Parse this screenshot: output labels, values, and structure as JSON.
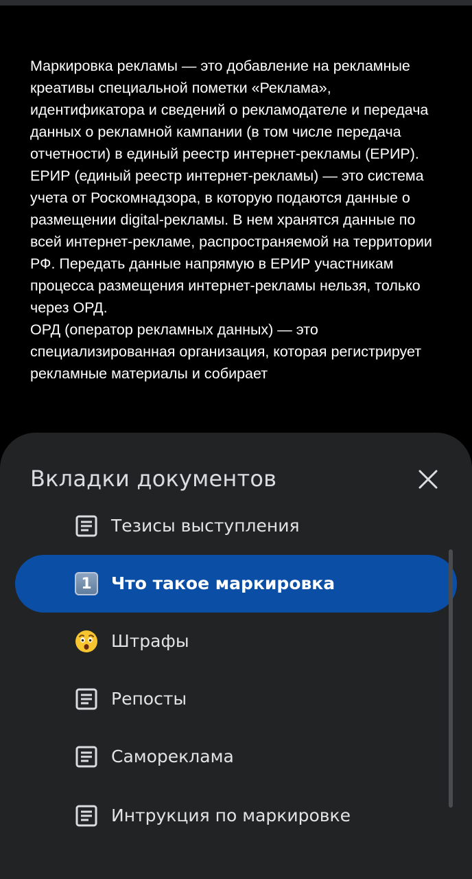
{
  "document": {
    "paragraphs": [
      "Маркировка рекламы — это добавление на рекламные креативы специальной пометки «Реклама», идентификатора и сведений о рекламодателе и передача данных о рекламной кампании (в том числе передача отчетности) в единый реестр интернет-рекламы (ЕРИР).",
      "ЕРИР (единый реестр интернет-рекламы) — это система учета от Роскомнадзора, в которую подаются данные о размещении digital-рекламы. В нем хранятся данные по всей интернет-рекламе, распространяемой на территории РФ. Передать данные напрямую в ЕРИР участникам процесса размещения интернет-рекламы нельзя, только через ОРД.",
      "ОРД (оператор рекламных данных) — это специализированная организация, которая регистрирует рекламные материалы и собирает"
    ]
  },
  "sheet": {
    "title": "Вкладки документов",
    "close_icon": "close-icon",
    "tabs": [
      {
        "label": "Тезисы выступления",
        "icon": "document-icon",
        "active": false
      },
      {
        "label": "Что такое маркировка",
        "icon": "keycap-one-icon",
        "active": true
      },
      {
        "label": "Штрафы",
        "icon": "astonished-face-icon",
        "active": false
      },
      {
        "label": "Репосты",
        "icon": "document-icon",
        "active": false
      },
      {
        "label": "Самореклама",
        "icon": "document-icon",
        "active": false
      },
      {
        "label": "Интрукция по маркировке",
        "icon": "document-icon",
        "active": false
      }
    ],
    "active_badge_text": "1"
  },
  "colors": {
    "background": "#000000",
    "sheet": "#222325",
    "active_tab": "#0b4ea6",
    "text": "#e3e3e3"
  }
}
